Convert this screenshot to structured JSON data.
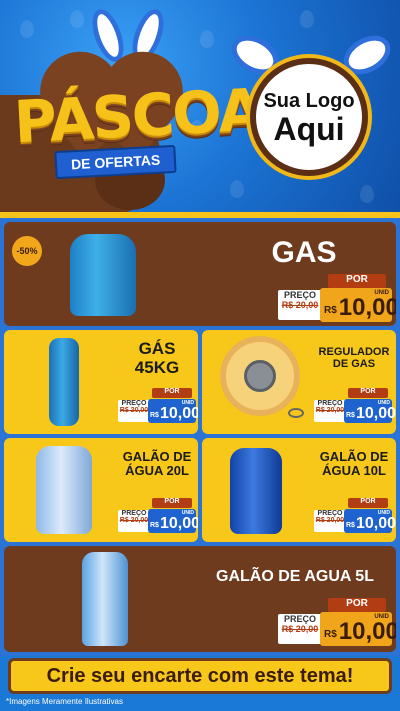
{
  "header": {
    "title": "PÁSCOA",
    "ribbon": "DE OFERTAS",
    "logo_line1": "Sua Logo",
    "logo_line2": "Aqui"
  },
  "products": [
    {
      "name": "GAS",
      "badge": "-50%",
      "old_label": "PREÇO",
      "old_price": "R$ 20,00",
      "por": "POR",
      "currency": "R$",
      "price": "10,00",
      "unit": "UNID"
    },
    {
      "name": "GÁS 45KG",
      "old_label": "PREÇO",
      "old_price": "R$ 20,00",
      "por": "POR",
      "currency": "R$",
      "price": "10,00",
      "unit": "UNID"
    },
    {
      "name": "REGULADOR DE GAS",
      "old_label": "PREÇO",
      "old_price": "R$ 20,00",
      "por": "POR",
      "currency": "R$",
      "price": "10,00",
      "unit": "UNID"
    },
    {
      "name": "GALÃO DE ÁGUA 20L",
      "old_label": "PREÇO",
      "old_price": "R$ 20,00",
      "por": "POR",
      "currency": "R$",
      "price": "10,00",
      "unit": "UNID"
    },
    {
      "name": "GALÃO DE ÁGUA 10L",
      "old_label": "PREÇO",
      "old_price": "R$ 20,00",
      "por": "POR",
      "currency": "R$",
      "price": "10,00",
      "unit": "UNID"
    },
    {
      "name": "GALÃO DE AGUA 5L",
      "old_label": "PREÇO",
      "old_price": "R$ 20,00",
      "por": "POR",
      "currency": "R$",
      "price": "10,00",
      "unit": "UNID"
    }
  ],
  "footer": {
    "cta": "Crie seu encarte com este tema!",
    "disclaimer": "*Imagens Meramente Ilustrativas"
  },
  "colors": {
    "brown": "#6e3b1f",
    "yellow": "#f7c71a",
    "blue": "#1e63cf",
    "orange": "#f1a51a"
  }
}
